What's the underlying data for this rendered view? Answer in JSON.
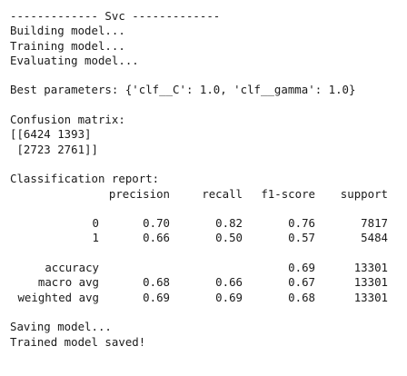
{
  "console": {
    "header": "------------- Svc -------------",
    "steps": [
      "Building model...",
      "Training model...",
      "Evaluating model..."
    ],
    "best_params": "Best parameters: {'clf__C': 1.0, 'clf__gamma': 1.0}",
    "confusion_title": "Confusion matrix:",
    "confusion_rows": [
      "[[6424 1393]",
      " [2723 2761]]"
    ],
    "report_title": "Classification report:",
    "report": {
      "headers": [
        "precision",
        "recall",
        "f1-score",
        "support"
      ],
      "class_rows": [
        {
          "label": "0",
          "precision": "0.70",
          "recall": "0.82",
          "f1": "0.76",
          "support": "7817"
        },
        {
          "label": "1",
          "precision": "0.66",
          "recall": "0.50",
          "f1": "0.57",
          "support": "5484"
        }
      ],
      "summary_rows": [
        {
          "label": "accuracy",
          "precision": "",
          "recall": "",
          "f1": "0.69",
          "support": "13301"
        },
        {
          "label": "macro avg",
          "precision": "0.68",
          "recall": "0.66",
          "f1": "0.67",
          "support": "13301"
        },
        {
          "label": "weighted avg",
          "precision": "0.69",
          "recall": "0.69",
          "f1": "0.68",
          "support": "13301"
        }
      ]
    },
    "footer": [
      "Saving model...",
      "Trained model saved!"
    ]
  }
}
